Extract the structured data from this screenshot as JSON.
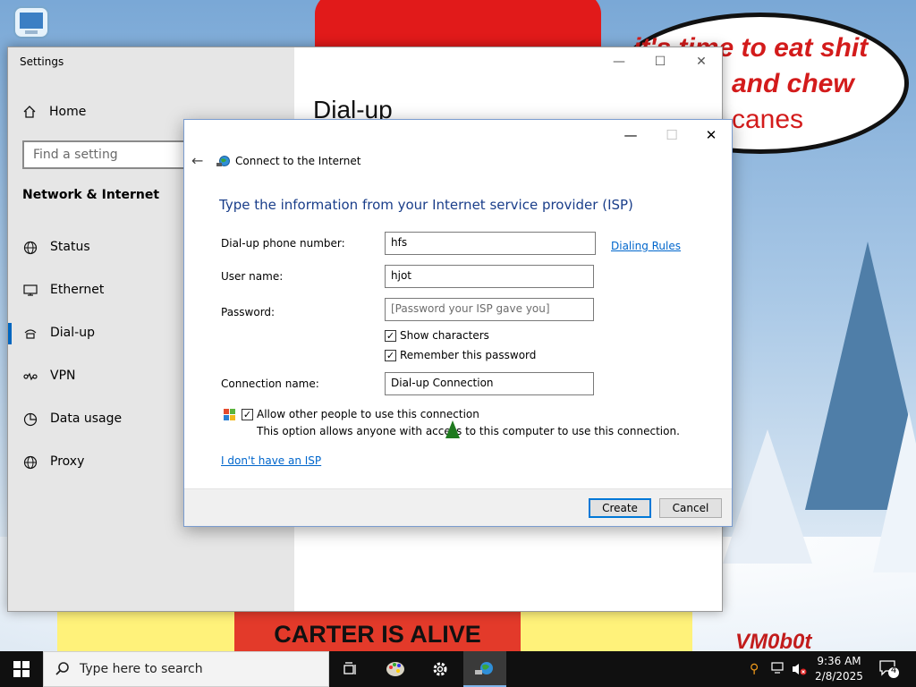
{
  "desktop": {
    "speech_lines": [
      "it's time to eat shit",
      "and chew",
      "canes"
    ],
    "banner": "CARTER IS ALIVE",
    "signature": "VM0b0t"
  },
  "settings": {
    "title": "Settings",
    "home_label": "Home",
    "search_placeholder": "Find a setting",
    "section_heading": "Network & Internet",
    "nav": [
      {
        "label": "Status",
        "icon": "globe-icon"
      },
      {
        "label": "Ethernet",
        "icon": "ethernet-icon"
      },
      {
        "label": "Dial-up",
        "icon": "dialup-icon",
        "active": true
      },
      {
        "label": "VPN",
        "icon": "vpn-icon"
      },
      {
        "label": "Data usage",
        "icon": "data-usage-icon"
      },
      {
        "label": "Proxy",
        "icon": "globe-icon"
      }
    ],
    "page_heading": "Dial-up"
  },
  "dialog": {
    "title": "Connect to the Internet",
    "heading": "Type the information from your Internet service provider (ISP)",
    "phone_label": "Dial-up phone number:",
    "phone_value": "hfs",
    "dialing_rules": "Dialing Rules",
    "user_label": "User name:",
    "user_value": "hjot",
    "password_label": "Password:",
    "password_placeholder": "[Password your ISP gave you]",
    "show_chars": "Show characters",
    "remember": "Remember this password",
    "conn_label": "Connection name:",
    "conn_value": "Dial-up Connection",
    "allow_others": "Allow other people to use this connection",
    "allow_note": "This option allows anyone with access to this computer to use this connection.",
    "no_isp": "I don't have an ISP",
    "create": "Create",
    "cancel": "Cancel"
  },
  "taskbar": {
    "search_placeholder": "Type here to search",
    "time": "9:36 AM",
    "date": "2/8/2025",
    "notification_count": "4"
  },
  "colors": {
    "accent": "#0078d7",
    "heading_blue": "#1a3e8a",
    "link": "#0066cc"
  }
}
